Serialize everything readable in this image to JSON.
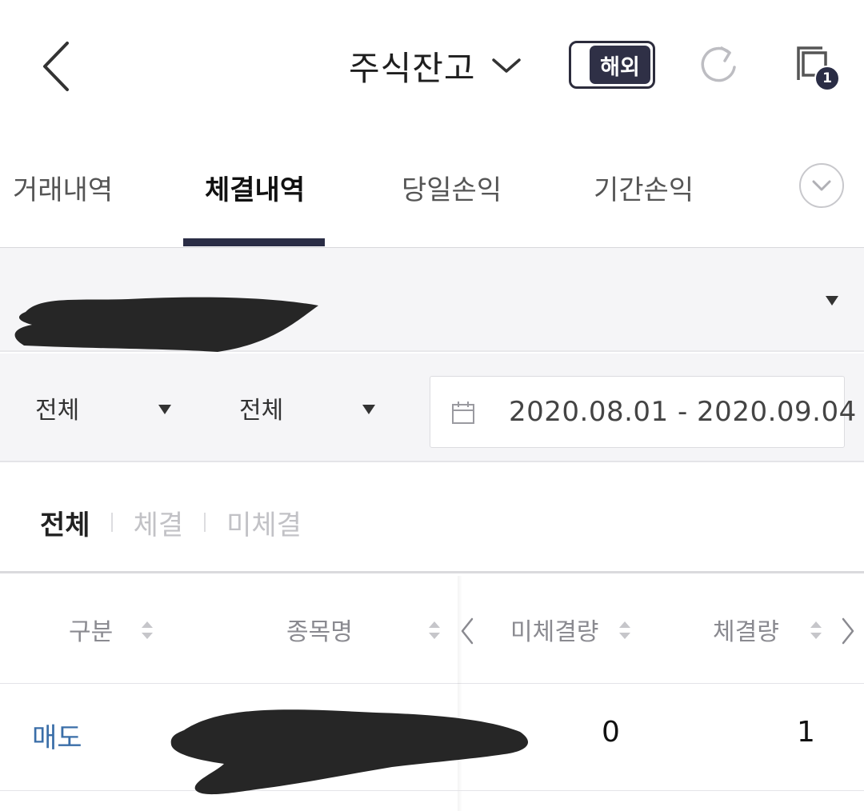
{
  "header": {
    "title": "주식잔고",
    "toggle_label": "해외",
    "windows_badge": "1"
  },
  "tabs": [
    {
      "label": "거래내역",
      "active": false
    },
    {
      "label": "체결내역",
      "active": true
    },
    {
      "label": "당일손익",
      "active": false
    },
    {
      "label": "기간손익",
      "active": false
    }
  ],
  "filters": {
    "select1": "전체",
    "select2": "전체",
    "date_range": "2020.08.01 - 2020.09.04"
  },
  "segments": [
    {
      "label": "전체",
      "active": true
    },
    {
      "label": "체결",
      "active": false
    },
    {
      "label": "미체결",
      "active": false
    }
  ],
  "table": {
    "columns": [
      "구분",
      "종목명",
      "미체결량",
      "체결량"
    ],
    "rows": [
      {
        "type": "매도",
        "unfilled": "0",
        "filled": "1"
      }
    ]
  },
  "colors": {
    "accent_navy": "#2a2d45",
    "sell_blue": "#3a6ea8",
    "panel_gray": "#f5f5f7"
  },
  "icons": [
    "back-icon",
    "chevron-down-icon",
    "refresh-icon",
    "windows-icon",
    "calendar-icon",
    "sort-icon",
    "caret-down-icon",
    "chevron-left-icon",
    "chevron-right-icon"
  ]
}
